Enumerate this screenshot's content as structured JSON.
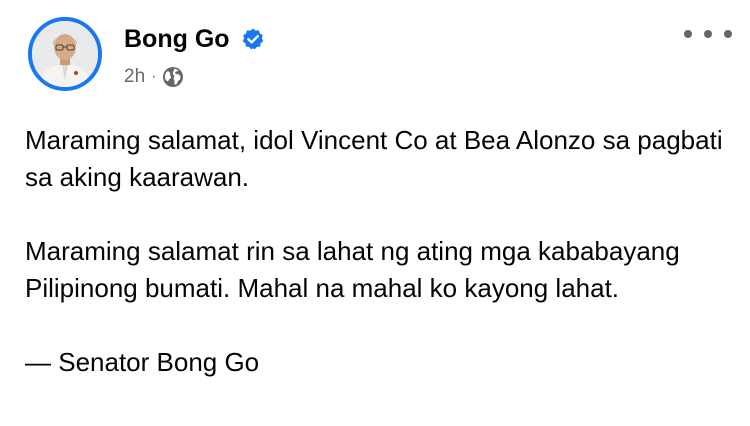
{
  "post": {
    "author": "Bong Go",
    "verified": true,
    "timestamp": "2h",
    "separator": "·",
    "audience_icon": "globe-icon",
    "more_icon": "more-options-icon",
    "paragraphs": [
      "Maraming salamat, idol Vincent Co at Bea Alonzo sa pagbati sa aking kaarawan.",
      "Maraming salamat rin sa lahat ng ating mga kababayang Pilipinong bumati. Mahal na mahal ko kayong lahat.",
      "— Senator Bong Go"
    ]
  },
  "colors": {
    "accent": "#1877f2",
    "secondary_text": "#65676b",
    "primary_text": "#050505"
  }
}
